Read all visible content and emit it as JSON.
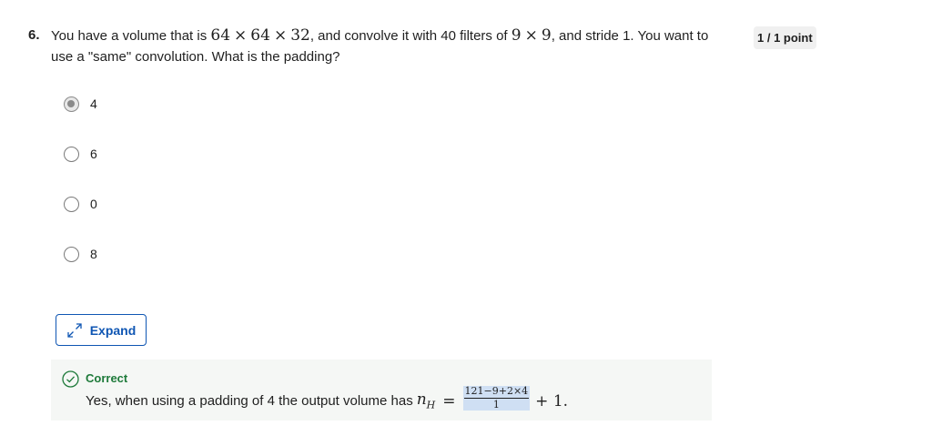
{
  "question": {
    "number": "6.",
    "text_part1": "You have a volume that is ",
    "dim1": "64",
    "times": "×",
    "dim2": "64",
    "dim3": "32",
    "text_part2": ", and convolve it with 40 filters of ",
    "filter1": "9",
    "filter2": "9",
    "text_part3": ", and stride 1. You want to use a \"same\" convolution. What is the padding?"
  },
  "points_badge": "1 / 1 point",
  "options": [
    {
      "label": "4",
      "selected": true
    },
    {
      "label": "6",
      "selected": false
    },
    {
      "label": "0",
      "selected": false
    },
    {
      "label": "8",
      "selected": false
    }
  ],
  "expand_button": {
    "label": "Expand",
    "icon": "expand-arrows-icon",
    "color": "#0f56b3"
  },
  "feedback": {
    "status": "Correct",
    "status_color": "#1e7a3a",
    "text": "Yes, when using a padding of 4 the output volume has",
    "var": "n",
    "var_sub": "H",
    "eq": "=",
    "frac_num": "121−9+2×4",
    "frac_den": "1",
    "tail": "+ 1."
  }
}
